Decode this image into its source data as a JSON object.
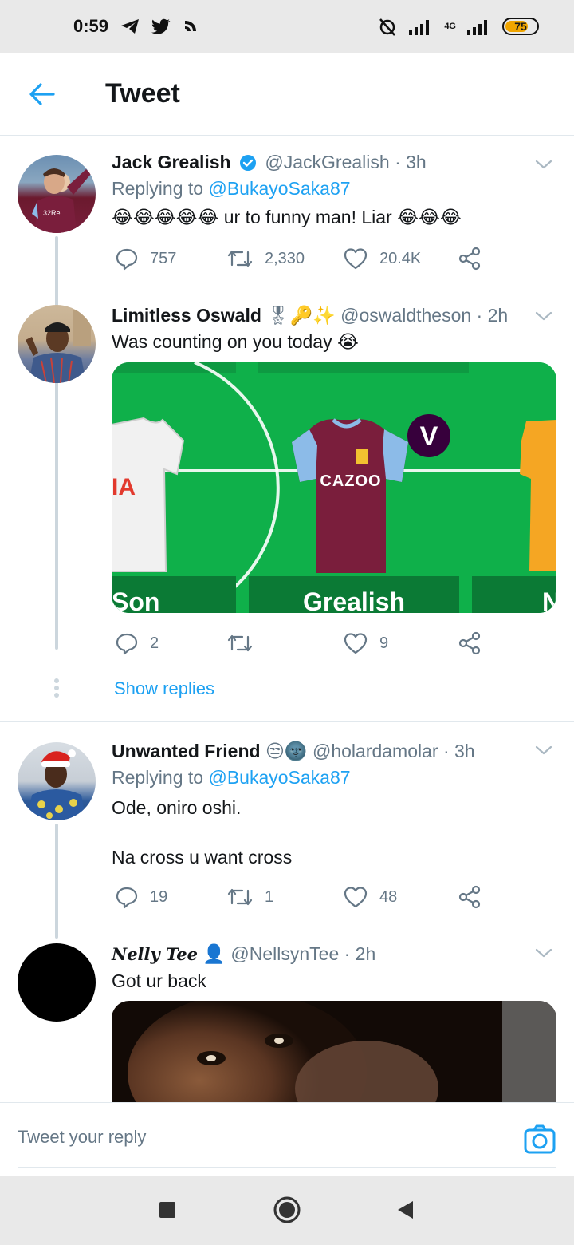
{
  "status_bar": {
    "time": "0:59",
    "network": "4G",
    "battery": "75",
    "battery_level_pct": 75
  },
  "header": {
    "title": "Tweet",
    "back_icon": "arrow-left-icon"
  },
  "tweets": [
    {
      "name": "Jack Grealish",
      "verified": true,
      "handle": "@JackGrealish · 3h",
      "replying_prefix": "Replying to ",
      "replying_to": "@BukayoSaka87",
      "text": "😂😂😂😂😂 ur to funny man! Liar 😂😂😂",
      "replies": "757",
      "retweets": "2,330",
      "likes": "20.4K"
    },
    {
      "name": "Limitless Oswald",
      "name_emoji": "🎖🔑✨",
      "handle": "@oswaldtheson · 2h",
      "text": "Was counting on you today 😭",
      "media": {
        "players": [
          "Son",
          "Grealish",
          "N"
        ],
        "vice_captain_badge": "V",
        "shirt_sponsor": "CAZOO"
      },
      "replies": "2",
      "retweets": "",
      "likes": "9",
      "show_replies_label": "Show replies"
    },
    {
      "name": "Unwanted Friend",
      "name_emoji": "😒🌚",
      "handle": "@holardamolar · 3h",
      "replying_prefix": "Replying to ",
      "replying_to": "@BukayoSaka87",
      "text_line1": "Ode, oniro oshi.",
      "text_line2": "Na cross u want cross",
      "replies": "19",
      "retweets": "1",
      "likes": "48"
    },
    {
      "name": "Nelly Tee",
      "name_emoji": "👤",
      "handle": "@NellsynTee · 2h",
      "text": "Got ur back"
    }
  ],
  "reply_bar": {
    "placeholder": "Tweet your reply",
    "camera_icon": "camera-icon"
  },
  "nav_bar": {
    "buttons": [
      "recents-square-icon",
      "home-circle-icon",
      "back-triangle-icon"
    ]
  },
  "colors": {
    "accent": "#1da1f2",
    "muted": "#657786",
    "pitch_green": "#0fb04a",
    "villa_claret": "#7a1e3c",
    "villa_blue": "#8cbbe8"
  }
}
